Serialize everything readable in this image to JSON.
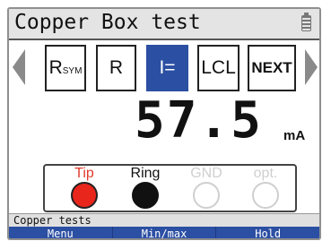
{
  "title": "Copper Box test",
  "function_keys": [
    {
      "label": "R",
      "sub": "SYM",
      "active": false
    },
    {
      "label": "R",
      "sub": "",
      "active": false
    },
    {
      "label": "I=",
      "sub": "",
      "active": true
    },
    {
      "label": "LCL",
      "sub": "",
      "active": false
    },
    {
      "label": "NEXT",
      "sub": "",
      "active": false
    }
  ],
  "reading": {
    "value": "57.5",
    "unit": "mA"
  },
  "leads": [
    {
      "label": "Tip",
      "label_color": "#e03a2b",
      "fill": "#e8261c",
      "border": "#222222"
    },
    {
      "label": "Ring",
      "label_color": "#111111",
      "fill": "#111111",
      "border": "#111111"
    },
    {
      "label": "GND",
      "label_color": "#cfcfcf",
      "fill": "#ffffff",
      "border": "#cfcfcf"
    },
    {
      "label": "opt.",
      "label_color": "#cfcfcf",
      "fill": "#ffffff",
      "border": "#cfcfcf"
    }
  ],
  "status_text": "Copper tests",
  "softkeys": [
    "Menu",
    "Min/max",
    "Hold"
  ],
  "colors": {
    "accent": "#2b4fa3",
    "titlebar": "#e4e4e4"
  }
}
